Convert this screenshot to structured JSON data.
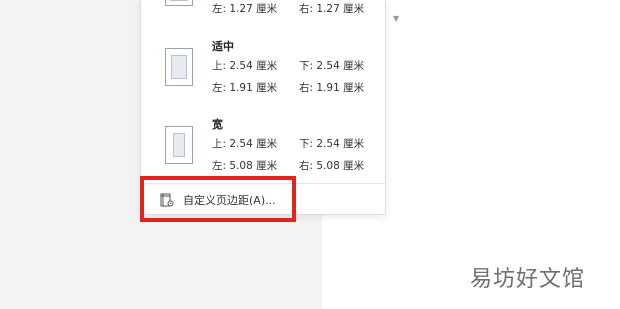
{
  "margins_menu": {
    "presets": [
      {
        "name": "",
        "left": "左: 1.27 厘米",
        "right": "右: 1.27 厘米"
      },
      {
        "name": "适中",
        "top": "上: 2.54 厘米",
        "bottom": "下: 2.54 厘米",
        "left": "左: 1.91 厘米",
        "right": "右: 1.91 厘米"
      },
      {
        "name": "宽",
        "top": "上: 2.54 厘米",
        "bottom": "下: 2.54 厘米",
        "left": "左: 5.08 厘米",
        "right": "右: 5.08 厘米"
      }
    ],
    "custom_item": {
      "label": "自定义页边距(A)..."
    }
  },
  "highlight_color": "#e0261c",
  "watermark": {
    "text": "易坊好文馆"
  }
}
